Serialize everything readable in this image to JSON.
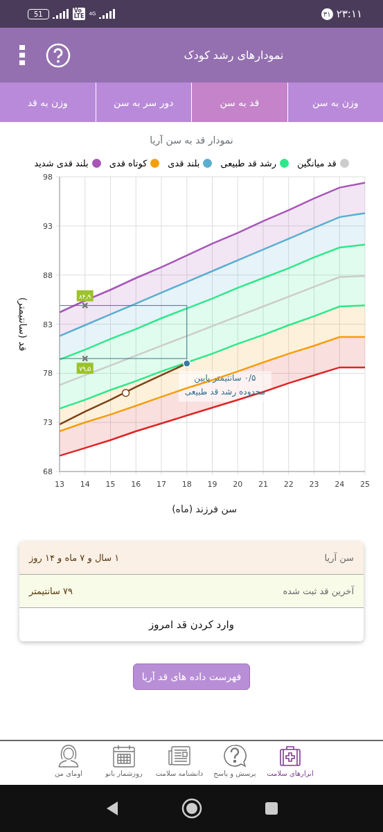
{
  "status_bar": {
    "time": "۲۳:۱۱",
    "badge": "۳۱",
    "battery": "51",
    "volte_top": "Vo",
    "volte_bottom": "LTE",
    "network": "4G"
  },
  "header": {
    "title": "نمودارهای رشد کودک"
  },
  "tabs": [
    {
      "label": "وزن به سن",
      "selected": false
    },
    {
      "label": "قد به سن",
      "selected": true
    },
    {
      "label": "دور سر به سن",
      "selected": false
    },
    {
      "label": "وزن به قد",
      "selected": false
    }
  ],
  "chart": {
    "title": "نمودار قد به سن آریا",
    "chart_data": {
      "type": "area",
      "xlabel": "سن فرزند (ماه)",
      "ylabel": "قد (سانتیمتر)",
      "x": [
        13,
        14,
        15,
        16,
        17,
        18,
        19,
        20,
        21,
        22,
        23,
        24,
        25
      ],
      "xlim": [
        13,
        25
      ],
      "ylim": [
        68,
        98
      ],
      "xticks": [
        13,
        14,
        15,
        16,
        17,
        18,
        19,
        20,
        21,
        22,
        23,
        24,
        25
      ],
      "yticks": [
        68,
        73,
        78,
        83,
        88,
        93,
        98
      ],
      "series": [
        {
          "name": "بلند قدی شدید",
          "color": "#a855b8",
          "values": [
            84.2,
            85.4,
            86.5,
            87.7,
            88.8,
            90.0,
            91.2,
            92.3,
            93.5,
            94.6,
            95.8,
            96.9,
            97.4
          ]
        },
        {
          "name": "کوتاه قدی",
          "color": "#f59e0b",
          "values": [
            72.1,
            73.0,
            73.8,
            74.7,
            75.6,
            76.5,
            77.3,
            78.2,
            79.1,
            80.0,
            80.8,
            81.7,
            81.7
          ]
        },
        {
          "name": "بلند قدی",
          "color": "#5aaed0",
          "values": [
            81.8,
            82.9,
            84.0,
            85.1,
            86.2,
            87.3,
            88.4,
            89.5,
            90.6,
            91.7,
            92.8,
            93.9,
            94.3
          ]
        },
        {
          "name": "رشد قد طبیعی",
          "color": "#2ee88a",
          "values": [
            79.4,
            80.4,
            81.5,
            82.5,
            83.6,
            84.6,
            85.6,
            86.7,
            87.7,
            88.7,
            89.8,
            90.8,
            91.1
          ]
        },
        {
          "name": "قد میانگین",
          "type": "line",
          "color": "#cccccc",
          "values": [
            76.8,
            77.8,
            78.8,
            79.8,
            80.8,
            81.8,
            82.8,
            83.8,
            84.8,
            85.8,
            86.8,
            87.8,
            87.9
          ]
        },
        {
          "type": "line",
          "color": "#2ee88a",
          "values": [
            74.4,
            75.3,
            76.3,
            77.2,
            78.2,
            79.1,
            80.0,
            81.0,
            81.9,
            82.9,
            83.8,
            84.8,
            84.9
          ]
        },
        {
          "type": "line",
          "color": "#dc2626",
          "values": [
            69.6,
            70.4,
            71.2,
            72.1,
            72.9,
            73.7,
            74.5,
            75.3,
            76.1,
            77.0,
            77.8,
            78.6,
            78.6
          ]
        },
        {
          "type": "line",
          "color": "#7a4218",
          "values": [
            72.8,
            74.1,
            75.3,
            76.6,
            77.8,
            79.0,
            null,
            null,
            null,
            null,
            null,
            null,
            null
          ]
        }
      ],
      "grid": true,
      "ref_lines": [
        {
          "axis": "y",
          "value": 84.9,
          "label": "۸۴٫۹"
        },
        {
          "axis": "y",
          "value": 79.5,
          "label": "۷۹٫۵"
        },
        {
          "axis": "x",
          "value": 18
        }
      ]
    },
    "note": [
      "۰/۵ سانتیمتر پایین",
      "محدوده رشد قد طبیعی"
    ]
  },
  "summary": {
    "rows": [
      {
        "label": "سن آریا",
        "value": "۱ سال و ۷ ماه و ۱۴ روز",
        "color": "#fbf0e6"
      },
      {
        "label": "آخرین قد ثبت شده",
        "value": "۷۹ سانتیمتر",
        "color": "#f8fbe8"
      }
    ],
    "action": "وارد کردن قد امروز"
  },
  "list_button": "فهرست داده های قد آریا",
  "bottom_nav": [
    {
      "label": "ابزارهای سلامت",
      "kind": "kit",
      "selected": true
    },
    {
      "label": "پرسش و پاسخ",
      "kind": "question",
      "selected": false
    },
    {
      "label": "دانشنامه سلامت",
      "kind": "news",
      "selected": false
    },
    {
      "label": "روزشمار بانو",
      "kind": "calendar",
      "selected": false
    },
    {
      "label": "اومای من",
      "kind": "person",
      "selected": false
    }
  ]
}
